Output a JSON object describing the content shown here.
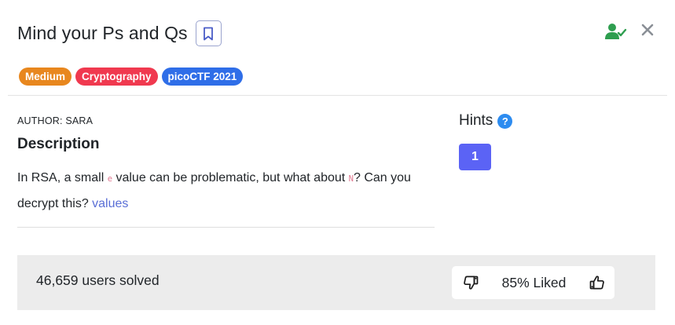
{
  "challenge": {
    "title": "Mind your Ps and Qs",
    "tags": [
      {
        "label": "Medium",
        "color": "#e8871e"
      },
      {
        "label": "Cryptography",
        "color": "#f0394f"
      },
      {
        "label": "picoCTF 2021",
        "color": "#2f6ee8"
      }
    ],
    "author": "AUTHOR: SARA",
    "description_heading": "Description",
    "description": {
      "part1": "In RSA, a small ",
      "code1": "e",
      "part2": " value can be problematic, but what about ",
      "code2": "N",
      "part3": "? Can you decrypt this? ",
      "link": "values"
    }
  },
  "hints": {
    "heading": "Hints",
    "help_icon": "question-circle-icon",
    "items": [
      "1"
    ]
  },
  "stats": {
    "solved_text": "46,659 users solved",
    "liked_text": "85% Liked"
  },
  "colors": {
    "solved_icon": "#2e9e4f",
    "hint_button": "#5b63f5",
    "link": "#5a6fd6"
  }
}
